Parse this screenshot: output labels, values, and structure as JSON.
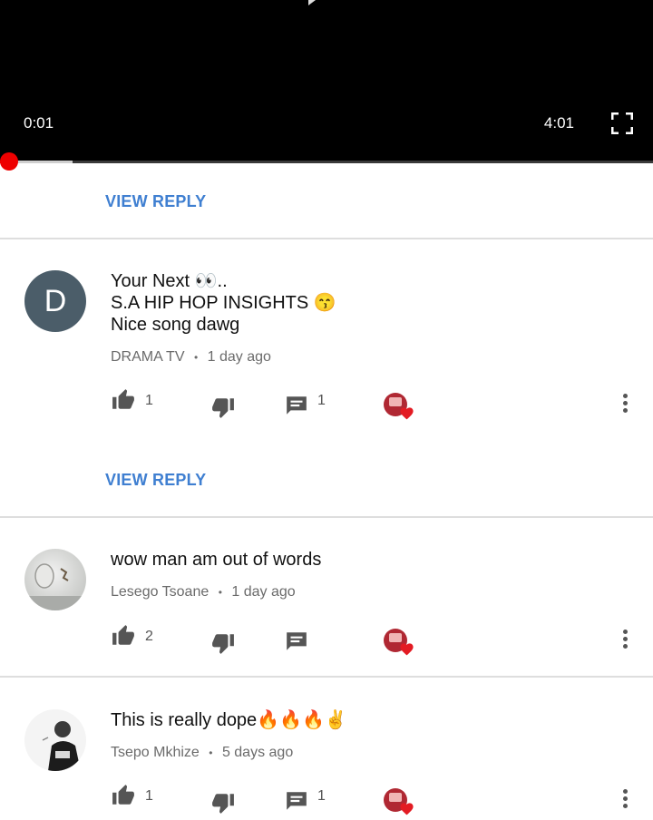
{
  "player": {
    "current_time": "0:01",
    "duration": "4:01",
    "progress_fraction": 0.004,
    "buffered_fraction": 0.11
  },
  "colors": {
    "accent_red": "#e00000",
    "link_blue": "#3f7fd1",
    "heart_red": "#e31b23"
  },
  "top_reply_link": "VIEW REPLY",
  "comments": [
    {
      "avatar_letter": "D",
      "lines": [
        "Your Next 👀..",
        "S.A HIP HOP  INSIGHTS 😙",
        "Nice song dawg"
      ],
      "author": "DRAMA TV",
      "separator": "•",
      "time": "1 day ago",
      "likes": "1",
      "replies": "1",
      "view_reply": "VIEW REPLY"
    },
    {
      "lines": [
        "wow man am out of words"
      ],
      "author": "Lesego Tsoane",
      "separator": "•",
      "time": "1 day ago",
      "likes": "2",
      "replies": ""
    },
    {
      "lines": [
        "This is really dope🔥🔥🔥✌"
      ],
      "author": "Tsepo Mkhize",
      "separator": "•",
      "time": "5 days ago",
      "likes": "1",
      "replies": "1"
    }
  ],
  "icons": [
    "thumb-up-icon",
    "thumb-down-icon",
    "reply-icon",
    "creator-heart-icon",
    "more-vert-icon",
    "fullscreen-icon"
  ]
}
